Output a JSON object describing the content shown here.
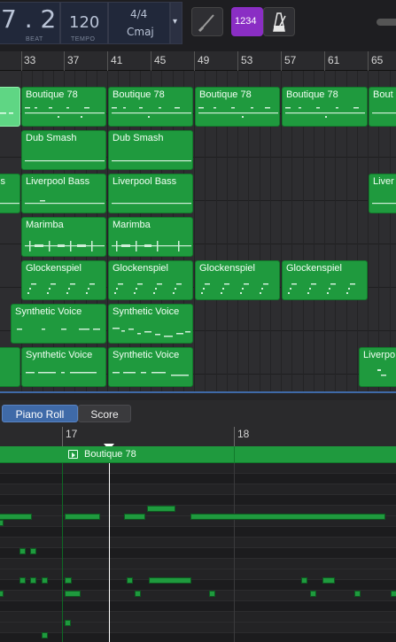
{
  "lcd": {
    "beat_value": "7 . 2",
    "beat_label": "BEAT",
    "tempo_value": "120",
    "tempo_label": "TEMPO",
    "signature": "4/4",
    "key": "Cmaj"
  },
  "controls": {
    "count_in_label": "1234",
    "accent_color": "#8a2ec4"
  },
  "ruler": {
    "bars": [
      "33",
      "37",
      "41",
      "45",
      "49",
      "53",
      "57",
      "61",
      "65"
    ]
  },
  "tracks": [
    {
      "regions": [
        {
          "name": ""
        },
        {
          "name": "Boutique 78"
        },
        {
          "name": "Boutique 78"
        },
        {
          "name": "Boutique 78"
        },
        {
          "name": "Boutique 78"
        },
        {
          "name": "Bout"
        }
      ]
    },
    {
      "regions": [
        {
          "name": "Dub Smash"
        },
        {
          "name": "Dub Smash"
        }
      ]
    },
    {
      "regions": [
        {
          "name": "ss"
        },
        {
          "name": "Liverpool Bass"
        },
        {
          "name": "Liverpool Bass"
        },
        {
          "name": "Liver"
        }
      ]
    },
    {
      "regions": [
        {
          "name": "Marimba"
        },
        {
          "name": "Marimba"
        }
      ]
    },
    {
      "regions": [
        {
          "name": "Glockenspiel"
        },
        {
          "name": "Glockenspiel"
        },
        {
          "name": "Glockenspiel"
        },
        {
          "name": "Glockenspiel"
        }
      ]
    },
    {
      "regions": [
        {
          "name": "Synthetic Voice"
        },
        {
          "name": "Synthetic Voice"
        }
      ]
    },
    {
      "regions": [
        {
          "name": ""
        },
        {
          "name": "Synthetic Voice"
        },
        {
          "name": "Synthetic Voice"
        },
        {
          "name": "Liverpo"
        }
      ]
    }
  ],
  "editor": {
    "tabs": [
      "Piano Roll",
      "Score"
    ],
    "active_tab": "Piano Roll",
    "bars": [
      "17",
      "18"
    ],
    "region_name": "Boutique 78"
  },
  "colors": {
    "region_green": "#1f9a3e",
    "selection_blue": "#3f6aa8"
  }
}
